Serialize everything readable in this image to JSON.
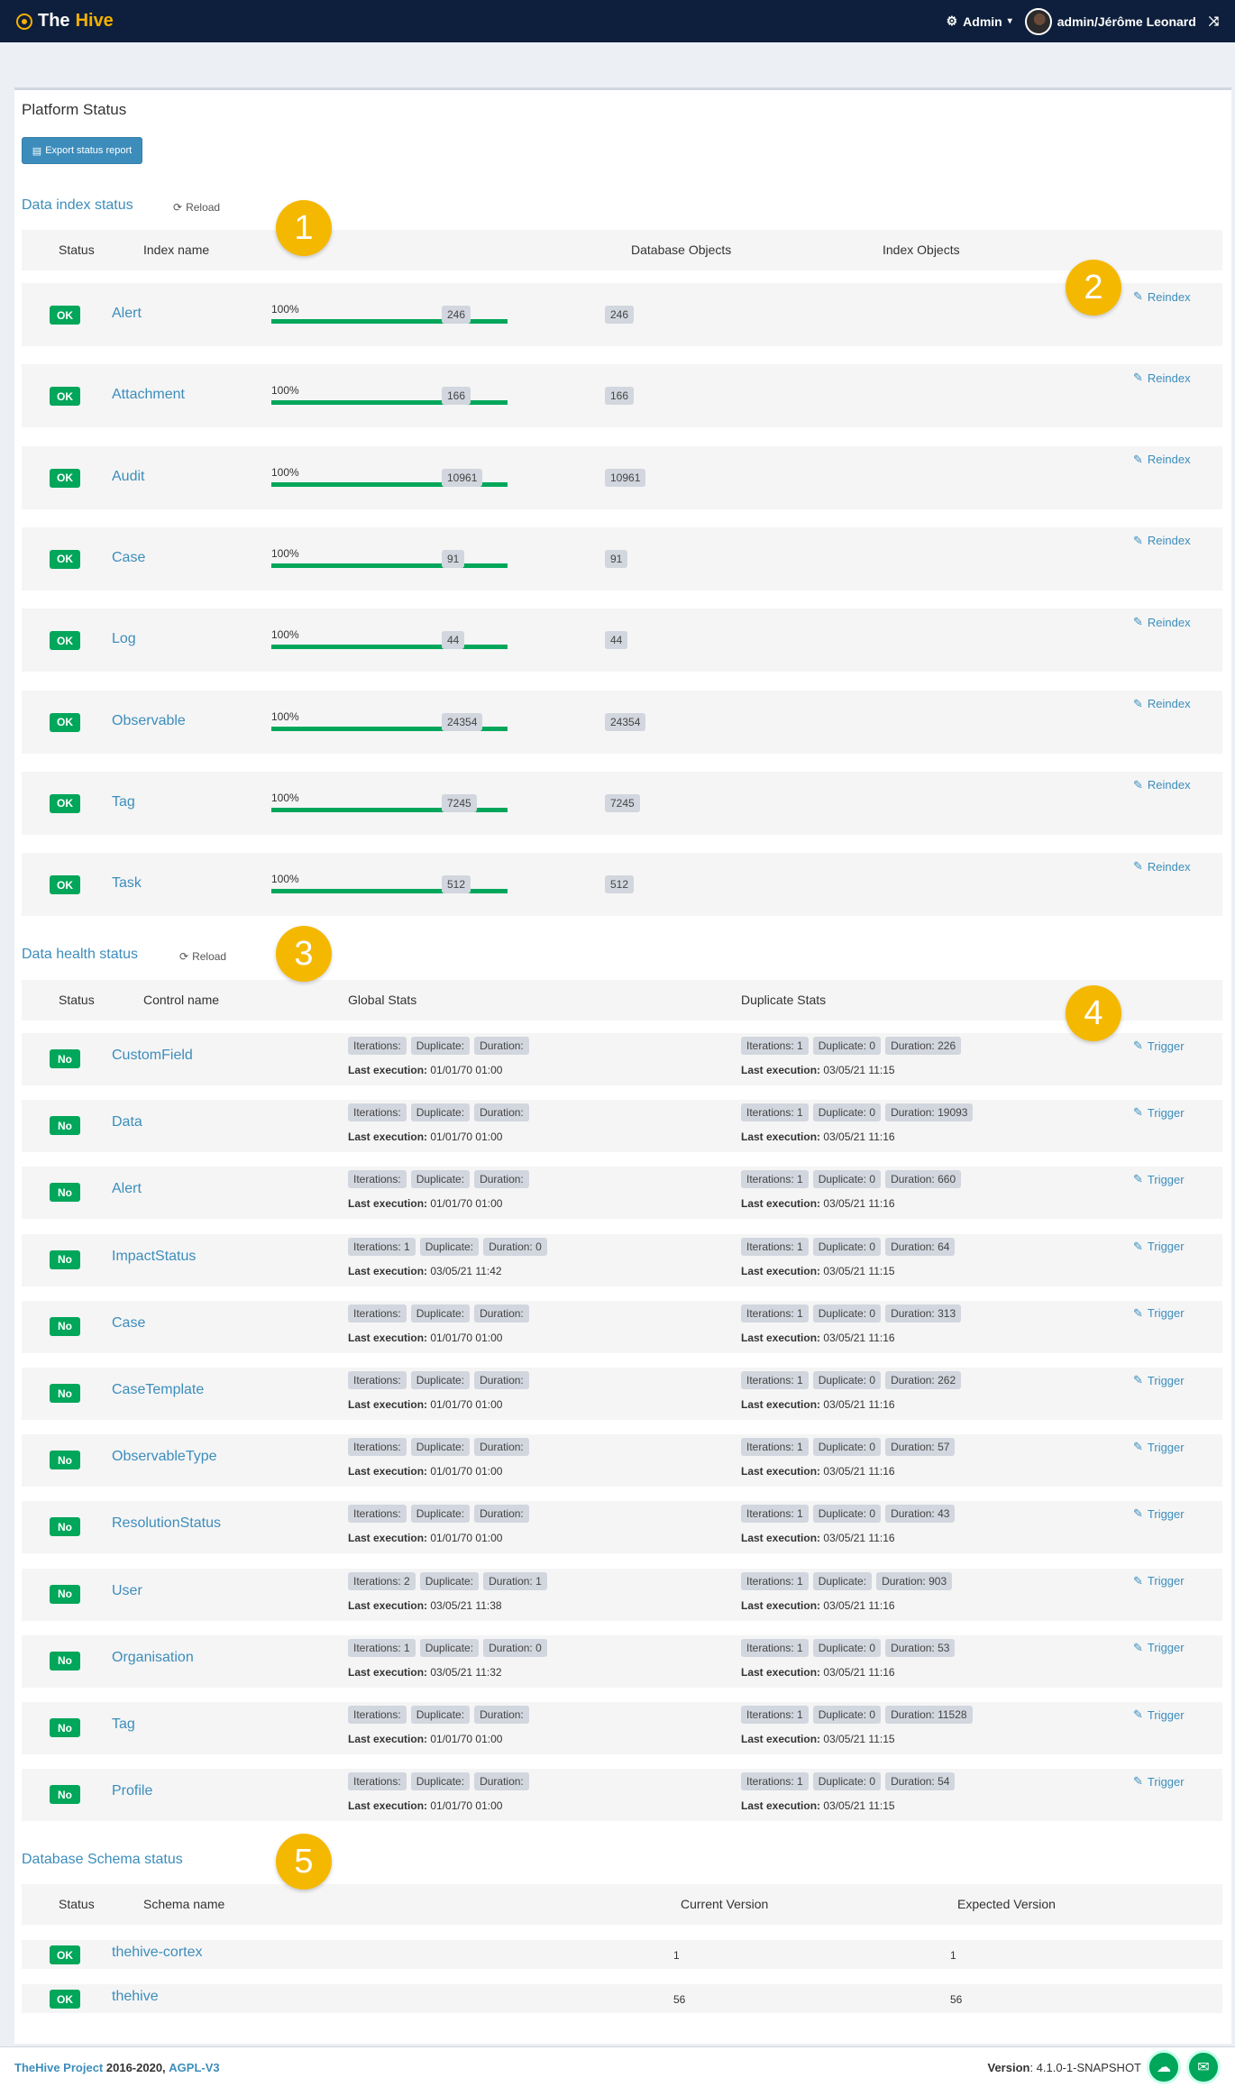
{
  "navbar": {
    "brand_prefix": "The",
    "brand_suffix": "Hive",
    "admin_label": "Admin",
    "user_label": "admin/Jérôme Leonard"
  },
  "page": {
    "title": "Platform Status",
    "export_label": "Export status report"
  },
  "index_status": {
    "title": "Data index status",
    "reload_label": "Reload",
    "headers": {
      "status": "Status",
      "name": "Index name",
      "db": "Database Objects",
      "idx": "Index Objects"
    },
    "action_label": "Reindex",
    "rows": [
      {
        "status": "OK",
        "name": "Alert",
        "progress": "100%",
        "db": "246",
        "idx": "246"
      },
      {
        "status": "OK",
        "name": "Attachment",
        "progress": "100%",
        "db": "166",
        "idx": "166"
      },
      {
        "status": "OK",
        "name": "Audit",
        "progress": "100%",
        "db": "10961",
        "idx": "10961"
      },
      {
        "status": "OK",
        "name": "Case",
        "progress": "100%",
        "db": "91",
        "idx": "91"
      },
      {
        "status": "OK",
        "name": "Log",
        "progress": "100%",
        "db": "44",
        "idx": "44"
      },
      {
        "status": "OK",
        "name": "Observable",
        "progress": "100%",
        "db": "24354",
        "idx": "24354"
      },
      {
        "status": "OK",
        "name": "Tag",
        "progress": "100%",
        "db": "7245",
        "idx": "7245"
      },
      {
        "status": "OK",
        "name": "Task",
        "progress": "100%",
        "db": "512",
        "idx": "512"
      }
    ]
  },
  "health_status": {
    "title": "Data health status",
    "reload_label": "Reload",
    "headers": {
      "status": "Status",
      "name": "Control name",
      "global": "Global Stats",
      "dup": "Duplicate Stats"
    },
    "action_label": "Trigger",
    "last_label": "Last execution:",
    "rows": [
      {
        "status": "No",
        "name": "CustomField",
        "g_it": "Iterations:",
        "g_dup": "Duplicate:",
        "g_dur": "Duration:",
        "g_last": "01/01/70 01:00",
        "d_it": "Iterations: 1",
        "d_dup": "Duplicate: 0",
        "d_dur": "Duration: 226",
        "d_last": "03/05/21 11:15"
      },
      {
        "status": "No",
        "name": "Data",
        "g_it": "Iterations:",
        "g_dup": "Duplicate:",
        "g_dur": "Duration:",
        "g_last": "01/01/70 01:00",
        "d_it": "Iterations: 1",
        "d_dup": "Duplicate: 0",
        "d_dur": "Duration: 19093",
        "d_last": "03/05/21 11:16"
      },
      {
        "status": "No",
        "name": "Alert",
        "g_it": "Iterations:",
        "g_dup": "Duplicate:",
        "g_dur": "Duration:",
        "g_last": "01/01/70 01:00",
        "d_it": "Iterations: 1",
        "d_dup": "Duplicate: 0",
        "d_dur": "Duration: 660",
        "d_last": "03/05/21 11:16"
      },
      {
        "status": "No",
        "name": "ImpactStatus",
        "g_it": "Iterations: 1",
        "g_dup": "Duplicate:",
        "g_dur": "Duration: 0",
        "g_last": "03/05/21 11:42",
        "d_it": "Iterations: 1",
        "d_dup": "Duplicate: 0",
        "d_dur": "Duration: 64",
        "d_last": "03/05/21 11:15"
      },
      {
        "status": "No",
        "name": "Case",
        "g_it": "Iterations:",
        "g_dup": "Duplicate:",
        "g_dur": "Duration:",
        "g_last": "01/01/70 01:00",
        "d_it": "Iterations: 1",
        "d_dup": "Duplicate: 0",
        "d_dur": "Duration: 313",
        "d_last": "03/05/21 11:16"
      },
      {
        "status": "No",
        "name": "CaseTemplate",
        "g_it": "Iterations:",
        "g_dup": "Duplicate:",
        "g_dur": "Duration:",
        "g_last": "01/01/70 01:00",
        "d_it": "Iterations: 1",
        "d_dup": "Duplicate: 0",
        "d_dur": "Duration: 262",
        "d_last": "03/05/21 11:16"
      },
      {
        "status": "No",
        "name": "ObservableType",
        "g_it": "Iterations:",
        "g_dup": "Duplicate:",
        "g_dur": "Duration:",
        "g_last": "01/01/70 01:00",
        "d_it": "Iterations: 1",
        "d_dup": "Duplicate: 0",
        "d_dur": "Duration: 57",
        "d_last": "03/05/21 11:16"
      },
      {
        "status": "No",
        "name": "ResolutionStatus",
        "g_it": "Iterations:",
        "g_dup": "Duplicate:",
        "g_dur": "Duration:",
        "g_last": "01/01/70 01:00",
        "d_it": "Iterations: 1",
        "d_dup": "Duplicate: 0",
        "d_dur": "Duration: 43",
        "d_last": "03/05/21 11:16"
      },
      {
        "status": "No",
        "name": "User",
        "g_it": "Iterations: 2",
        "g_dup": "Duplicate:",
        "g_dur": "Duration: 1",
        "g_last": "03/05/21 11:38",
        "d_it": "Iterations: 1",
        "d_dup": "Duplicate:",
        "d_dur": "Duration: 903",
        "d_last": "03/05/21 11:16"
      },
      {
        "status": "No",
        "name": "Organisation",
        "g_it": "Iterations: 1",
        "g_dup": "Duplicate:",
        "g_dur": "Duration: 0",
        "g_last": "03/05/21 11:32",
        "d_it": "Iterations: 1",
        "d_dup": "Duplicate: 0",
        "d_dur": "Duration: 53",
        "d_last": "03/05/21 11:16"
      },
      {
        "status": "No",
        "name": "Tag",
        "g_it": "Iterations:",
        "g_dup": "Duplicate:",
        "g_dur": "Duration:",
        "g_last": "01/01/70 01:00",
        "d_it": "Iterations: 1",
        "d_dup": "Duplicate: 0",
        "d_dur": "Duration: 11528",
        "d_last": "03/05/21 11:15"
      },
      {
        "status": "No",
        "name": "Profile",
        "g_it": "Iterations:",
        "g_dup": "Duplicate:",
        "g_dur": "Duration:",
        "g_last": "01/01/70 01:00",
        "d_it": "Iterations: 1",
        "d_dup": "Duplicate: 0",
        "d_dur": "Duration: 54",
        "d_last": "03/05/21 11:15"
      }
    ]
  },
  "schema_status": {
    "title": "Database Schema status",
    "headers": {
      "status": "Status",
      "name": "Schema name",
      "current": "Current Version",
      "expected": "Expected Version"
    },
    "rows": [
      {
        "status": "OK",
        "name": "thehive-cortex",
        "current": "1",
        "expected": "1"
      },
      {
        "status": "OK",
        "name": "thehive",
        "current": "56",
        "expected": "56"
      }
    ]
  },
  "callouts": [
    "1",
    "2",
    "3",
    "4",
    "5"
  ],
  "footer": {
    "project": "TheHive Project",
    "years": " 2016-2020, ",
    "license": "AGPL-V3",
    "version_label": "Version",
    "version_value": ": 4.1.0-1-SNAPSHOT"
  },
  "colors": {
    "navbar": "#0d1f3c",
    "accent": "#3c8dbc",
    "ok": "#00a65a",
    "callout": "#f5b800"
  }
}
